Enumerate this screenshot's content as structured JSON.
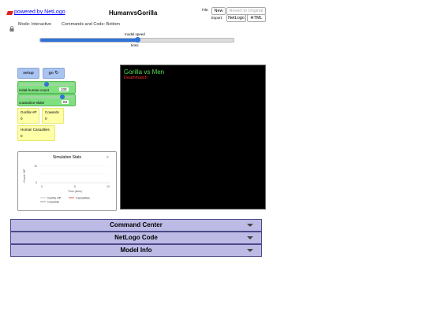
{
  "header": {
    "powered_by": "powered by NetLogo",
    "model_title": "HumanvsGorilla",
    "file_label": "File:",
    "new_label": "New",
    "revert_label": "Revert to Original",
    "export_label": "Export:",
    "netlogo_label": "NetLogo",
    "html_label": "HTML",
    "mode_text": "Mode: Interactive",
    "commands_code_text": "Commands and Code: Bottom"
  },
  "speed": {
    "label": "model speed",
    "ticks_label": "ticks:",
    "value": 0.5
  },
  "controls": {
    "setup_label": "setup",
    "go_label": "go",
    "sliders": [
      {
        "label": "initial-human-count",
        "value": "100",
        "fill": 0.5
      },
      {
        "label": "cowardice-slider",
        "value": "83",
        "fill": 0.83
      }
    ],
    "monitors": [
      {
        "label": "Gorilla HP",
        "value": "0"
      },
      {
        "label": "Cowards",
        "value": "0"
      },
      {
        "label": "Human Casualties",
        "value": "0"
      }
    ]
  },
  "plot": {
    "title": "Simulation Stats",
    "ylabel": "Count / HP",
    "xlabel": "Time (ticks)",
    "yticks": [
      "10",
      "0"
    ],
    "xticks": [
      "0",
      "5",
      "10"
    ],
    "legend": [
      {
        "name": "Gorilla HP",
        "color": "#b7b7b7"
      },
      {
        "name": "Casualties",
        "color": "#e03030"
      },
      {
        "name": "Cowards",
        "color": "#808080"
      }
    ]
  },
  "view": {
    "heading": "Gorilla vs Men",
    "subheading": "Deathmatch",
    "heading_color": "#55dd55",
    "subheading_color": "#ee3333"
  },
  "tabs": [
    {
      "label": "Command Center"
    },
    {
      "label": "NetLogo Code"
    },
    {
      "label": "Model Info"
    }
  ]
}
